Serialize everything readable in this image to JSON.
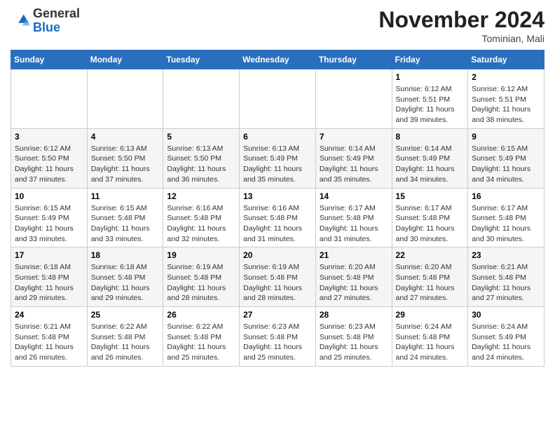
{
  "header": {
    "logo_general": "General",
    "logo_blue": "Blue",
    "month_title": "November 2024",
    "location": "Tominian, Mali"
  },
  "weekdays": [
    "Sunday",
    "Monday",
    "Tuesday",
    "Wednesday",
    "Thursday",
    "Friday",
    "Saturday"
  ],
  "weeks": [
    [
      null,
      null,
      null,
      null,
      null,
      {
        "day": "1",
        "sunrise": "Sunrise: 6:12 AM",
        "sunset": "Sunset: 5:51 PM",
        "daylight": "Daylight: 11 hours and 39 minutes."
      },
      {
        "day": "2",
        "sunrise": "Sunrise: 6:12 AM",
        "sunset": "Sunset: 5:51 PM",
        "daylight": "Daylight: 11 hours and 38 minutes."
      }
    ],
    [
      {
        "day": "3",
        "sunrise": "Sunrise: 6:12 AM",
        "sunset": "Sunset: 5:50 PM",
        "daylight": "Daylight: 11 hours and 37 minutes."
      },
      {
        "day": "4",
        "sunrise": "Sunrise: 6:13 AM",
        "sunset": "Sunset: 5:50 PM",
        "daylight": "Daylight: 11 hours and 37 minutes."
      },
      {
        "day": "5",
        "sunrise": "Sunrise: 6:13 AM",
        "sunset": "Sunset: 5:50 PM",
        "daylight": "Daylight: 11 hours and 36 minutes."
      },
      {
        "day": "6",
        "sunrise": "Sunrise: 6:13 AM",
        "sunset": "Sunset: 5:49 PM",
        "daylight": "Daylight: 11 hours and 35 minutes."
      },
      {
        "day": "7",
        "sunrise": "Sunrise: 6:14 AM",
        "sunset": "Sunset: 5:49 PM",
        "daylight": "Daylight: 11 hours and 35 minutes."
      },
      {
        "day": "8",
        "sunrise": "Sunrise: 6:14 AM",
        "sunset": "Sunset: 5:49 PM",
        "daylight": "Daylight: 11 hours and 34 minutes."
      },
      {
        "day": "9",
        "sunrise": "Sunrise: 6:15 AM",
        "sunset": "Sunset: 5:49 PM",
        "daylight": "Daylight: 11 hours and 34 minutes."
      }
    ],
    [
      {
        "day": "10",
        "sunrise": "Sunrise: 6:15 AM",
        "sunset": "Sunset: 5:49 PM",
        "daylight": "Daylight: 11 hours and 33 minutes."
      },
      {
        "day": "11",
        "sunrise": "Sunrise: 6:15 AM",
        "sunset": "Sunset: 5:48 PM",
        "daylight": "Daylight: 11 hours and 33 minutes."
      },
      {
        "day": "12",
        "sunrise": "Sunrise: 6:16 AM",
        "sunset": "Sunset: 5:48 PM",
        "daylight": "Daylight: 11 hours and 32 minutes."
      },
      {
        "day": "13",
        "sunrise": "Sunrise: 6:16 AM",
        "sunset": "Sunset: 5:48 PM",
        "daylight": "Daylight: 11 hours and 31 minutes."
      },
      {
        "day": "14",
        "sunrise": "Sunrise: 6:17 AM",
        "sunset": "Sunset: 5:48 PM",
        "daylight": "Daylight: 11 hours and 31 minutes."
      },
      {
        "day": "15",
        "sunrise": "Sunrise: 6:17 AM",
        "sunset": "Sunset: 5:48 PM",
        "daylight": "Daylight: 11 hours and 30 minutes."
      },
      {
        "day": "16",
        "sunrise": "Sunrise: 6:17 AM",
        "sunset": "Sunset: 5:48 PM",
        "daylight": "Daylight: 11 hours and 30 minutes."
      }
    ],
    [
      {
        "day": "17",
        "sunrise": "Sunrise: 6:18 AM",
        "sunset": "Sunset: 5:48 PM",
        "daylight": "Daylight: 11 hours and 29 minutes."
      },
      {
        "day": "18",
        "sunrise": "Sunrise: 6:18 AM",
        "sunset": "Sunset: 5:48 PM",
        "daylight": "Daylight: 11 hours and 29 minutes."
      },
      {
        "day": "19",
        "sunrise": "Sunrise: 6:19 AM",
        "sunset": "Sunset: 5:48 PM",
        "daylight": "Daylight: 11 hours and 28 minutes."
      },
      {
        "day": "20",
        "sunrise": "Sunrise: 6:19 AM",
        "sunset": "Sunset: 5:48 PM",
        "daylight": "Daylight: 11 hours and 28 minutes."
      },
      {
        "day": "21",
        "sunrise": "Sunrise: 6:20 AM",
        "sunset": "Sunset: 5:48 PM",
        "daylight": "Daylight: 11 hours and 27 minutes."
      },
      {
        "day": "22",
        "sunrise": "Sunrise: 6:20 AM",
        "sunset": "Sunset: 5:48 PM",
        "daylight": "Daylight: 11 hours and 27 minutes."
      },
      {
        "day": "23",
        "sunrise": "Sunrise: 6:21 AM",
        "sunset": "Sunset: 5:48 PM",
        "daylight": "Daylight: 11 hours and 27 minutes."
      }
    ],
    [
      {
        "day": "24",
        "sunrise": "Sunrise: 6:21 AM",
        "sunset": "Sunset: 5:48 PM",
        "daylight": "Daylight: 11 hours and 26 minutes."
      },
      {
        "day": "25",
        "sunrise": "Sunrise: 6:22 AM",
        "sunset": "Sunset: 5:48 PM",
        "daylight": "Daylight: 11 hours and 26 minutes."
      },
      {
        "day": "26",
        "sunrise": "Sunrise: 6:22 AM",
        "sunset": "Sunset: 5:48 PM",
        "daylight": "Daylight: 11 hours and 25 minutes."
      },
      {
        "day": "27",
        "sunrise": "Sunrise: 6:23 AM",
        "sunset": "Sunset: 5:48 PM",
        "daylight": "Daylight: 11 hours and 25 minutes."
      },
      {
        "day": "28",
        "sunrise": "Sunrise: 6:23 AM",
        "sunset": "Sunset: 5:48 PM",
        "daylight": "Daylight: 11 hours and 25 minutes."
      },
      {
        "day": "29",
        "sunrise": "Sunrise: 6:24 AM",
        "sunset": "Sunset: 5:48 PM",
        "daylight": "Daylight: 11 hours and 24 minutes."
      },
      {
        "day": "30",
        "sunrise": "Sunrise: 6:24 AM",
        "sunset": "Sunset: 5:49 PM",
        "daylight": "Daylight: 11 hours and 24 minutes."
      }
    ]
  ]
}
